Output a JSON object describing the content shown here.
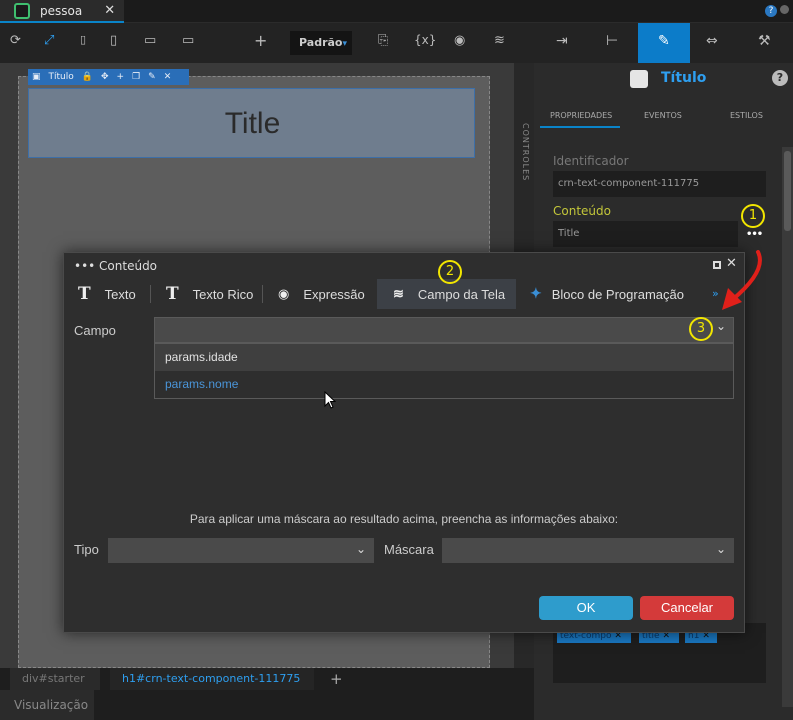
{
  "file_tab": {
    "name": "pessoa",
    "close": "✕"
  },
  "toolbar": {
    "device_label": "Padrão",
    "device_arrow": "▾",
    "plus": "+",
    "expr": "{x}"
  },
  "right_panel": {
    "component_title": "Título",
    "help": "?",
    "tabs": [
      "PROPRIEDADES",
      "EVENTOS",
      "ESTILOS"
    ],
    "identifier_label": "Identificador",
    "identifier_value": "crn-text-component-111775",
    "content_label": "Conteúdo",
    "content_value": "Title",
    "more_dots": "•••",
    "tags": [
      "text-compo",
      "title",
      "h1"
    ]
  },
  "canvas": {
    "selection_label": "Título",
    "title_text": "Title",
    "side_strip": "CONTROLES"
  },
  "breadcrumbs": {
    "item1": "div#starter",
    "item2": "h1#crn-text-component-111775",
    "add": "+"
  },
  "bottom_tab": "Visualização",
  "modal": {
    "title": "••• Conteúdo",
    "tabs": [
      {
        "icon": "T",
        "label": "Texto"
      },
      {
        "icon": "T",
        "label": "Texto Rico"
      },
      {
        "icon": "◉",
        "label": "Expressão"
      },
      {
        "icon": "≋",
        "label": "Campo da Tela"
      },
      {
        "icon": "✦",
        "label": "Bloco de Programação"
      }
    ],
    "more": "»",
    "field_label": "Campo",
    "dropdown_options": [
      "params.idade",
      "params.nome"
    ],
    "mask_hint": "Para aplicar uma máscara ao resultado acima, preencha as informações abaixo:",
    "type_label": "Tipo",
    "mask_label": "Máscara",
    "ok": "OK",
    "cancel": "Cancelar"
  },
  "callouts": [
    "1",
    "2",
    "3"
  ],
  "colors": {
    "accent": "#0a84c9",
    "title_blue": "#2e9ff0",
    "ok": "#2e9ccc",
    "cancel": "#d43a3a",
    "callout": "#f2e600",
    "arrow": "#e0201a"
  }
}
